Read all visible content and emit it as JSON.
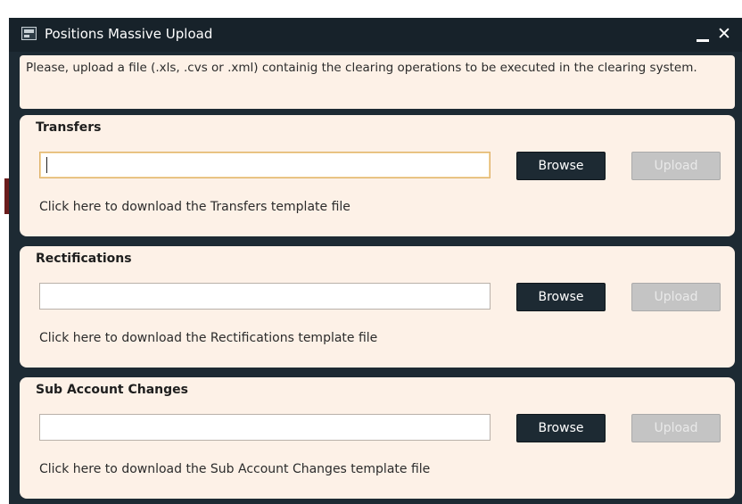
{
  "window": {
    "title": "Positions Massive Upload",
    "minimize_icon": "minimize-icon",
    "close_icon": "close-icon",
    "close_glyph": "✕"
  },
  "info": {
    "text": "Please, upload a file (.xls, .cvs or .xml) containig the clearing operations to be executed in the clearing system."
  },
  "sections": [
    {
      "title": "Transfers",
      "file_value": "",
      "browse_label": "Browse",
      "upload_label": "Upload",
      "download_text": "Click here to download the Transfers template file"
    },
    {
      "title": "Rectifications",
      "file_value": "",
      "browse_label": "Browse",
      "upload_label": "Upload",
      "download_text": "Click here to download the Rectifications template file"
    },
    {
      "title": "Sub Account Changes",
      "file_value": "",
      "browse_label": "Browse",
      "upload_label": "Upload",
      "download_text": "Click here to download the Sub Account Changes template file"
    }
  ],
  "colors": {
    "titlebar": "#17222a",
    "panel": "#fdf1e7",
    "browse_button": "#1d2a33",
    "upload_button_disabled": "#c4c4c4",
    "focus_border": "#e0b36a"
  }
}
